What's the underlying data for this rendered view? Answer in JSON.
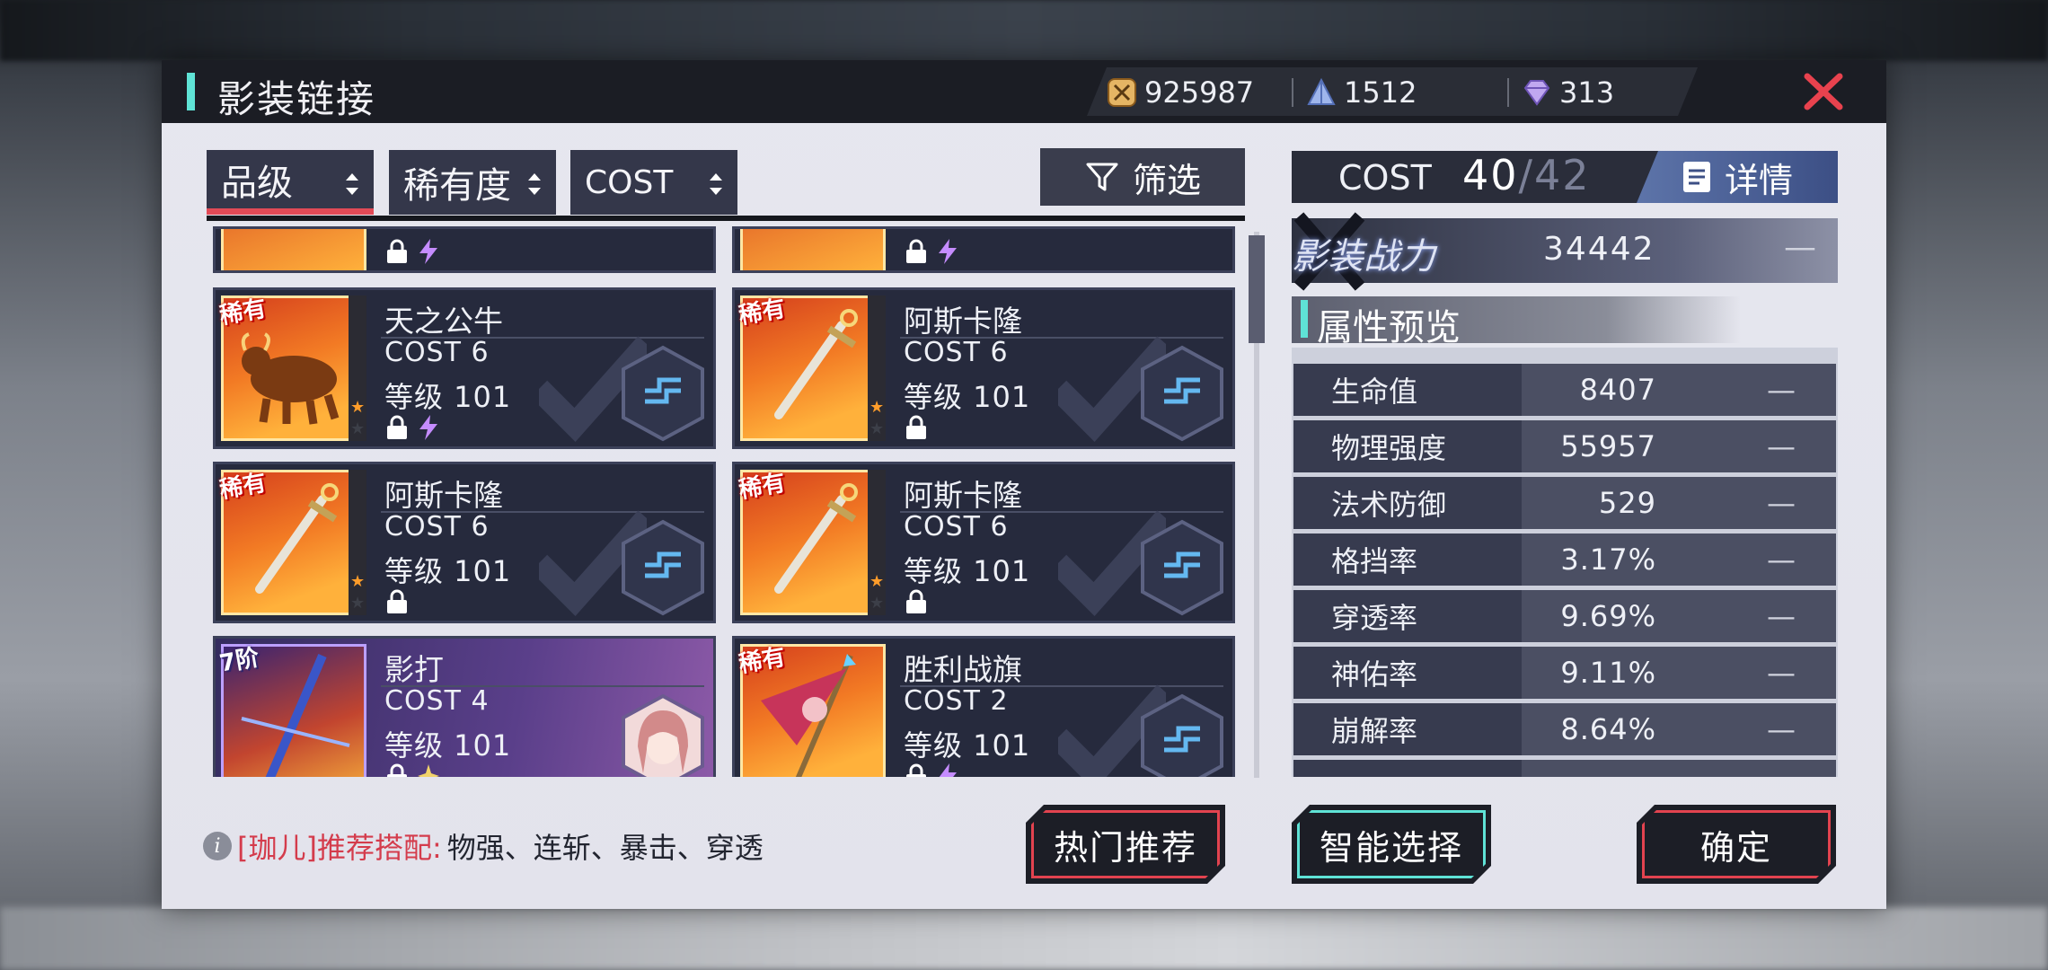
{
  "window": {
    "title": "影装链接"
  },
  "currencies": [
    {
      "name": "gold",
      "value": "925987"
    },
    {
      "name": "crystal",
      "value": "1512"
    },
    {
      "name": "diamond",
      "value": "313"
    }
  ],
  "sort_tabs": [
    "品级",
    "稀有度",
    "COST"
  ],
  "filter_label": "筛选",
  "items": [
    {
      "name": "天之公牛",
      "cost": "COST 6",
      "level": "等级 101",
      "badge": "稀有"
    },
    {
      "name": "阿斯卡隆",
      "cost": "COST 6",
      "level": "等级 101",
      "badge": "稀有"
    },
    {
      "name": "阿斯卡隆",
      "cost": "COST 6",
      "level": "等级 101",
      "badge": "稀有"
    },
    {
      "name": "阿斯卡隆",
      "cost": "COST 6",
      "level": "等级 101",
      "badge": "稀有"
    },
    {
      "name": "影打",
      "cost": "COST 4",
      "level": "等级 101",
      "badge": "7阶"
    },
    {
      "name": "胜利战旗",
      "cost": "COST 2",
      "level": "等级 101",
      "badge": "稀有"
    }
  ],
  "cost_panel": {
    "label": "COST",
    "current": "40",
    "max": "/42",
    "detail_label": "详情"
  },
  "power": {
    "label": "影装战力",
    "value": "34442",
    "delta": "—"
  },
  "attr_header": "属性预览",
  "attributes": [
    {
      "k": "生命值",
      "v": "8407",
      "d": "—"
    },
    {
      "k": "物理强度",
      "v": "55957",
      "d": "—"
    },
    {
      "k": "法术防御",
      "v": "529",
      "d": "—"
    },
    {
      "k": "格挡率",
      "v": "3.17%",
      "d": "—"
    },
    {
      "k": "穿透率",
      "v": "9.69%",
      "d": "—"
    },
    {
      "k": "神佑率",
      "v": "9.11%",
      "d": "—"
    },
    {
      "k": "崩解率",
      "v": "8.64%",
      "d": "—"
    }
  ],
  "recommend": {
    "prefix": "[珈儿]推荐搭配:",
    "text": "物强、连斩、暴击、穿透"
  },
  "buttons": {
    "hot": "热门推荐",
    "smart": "智能选择",
    "confirm": "确定"
  },
  "colors": {
    "accent": "#5fe3d6",
    "red": "#e24a56",
    "panel": "#e6e7ef"
  }
}
